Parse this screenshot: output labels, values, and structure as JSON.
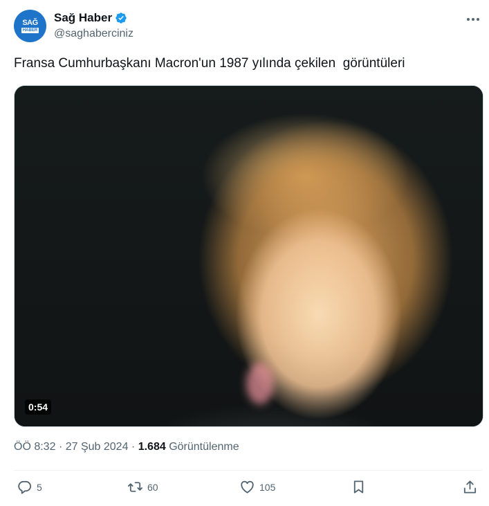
{
  "account": {
    "avatar_text_top": "SAĞ",
    "avatar_text_bottom": "HABER",
    "name": "Sağ Haber",
    "handle": "@saghaberciniz",
    "verified": true,
    "avatar_color": "#1d74c8"
  },
  "tweet": {
    "text": "Fransa Cumhurbaşkanı Macron'un 1987 yılında çekilen  görüntüleri"
  },
  "media": {
    "type": "video",
    "duration": "0:54"
  },
  "meta": {
    "time": "ÖÖ 8:32",
    "separator1": "·",
    "date": "27 Şub 2024",
    "separator2": "·",
    "views_count": "1.684",
    "views_label": "Görüntülenme"
  },
  "actions": {
    "reply_count": "5",
    "retweet_count": "60",
    "like_count": "105"
  },
  "icons": [
    "verified-icon",
    "more-icon",
    "reply-icon",
    "retweet-icon",
    "like-icon",
    "bookmark-icon",
    "share-icon"
  ],
  "colors": {
    "verified": "#1d9bf0",
    "text": "#0f1419",
    "secondary": "#536471"
  }
}
